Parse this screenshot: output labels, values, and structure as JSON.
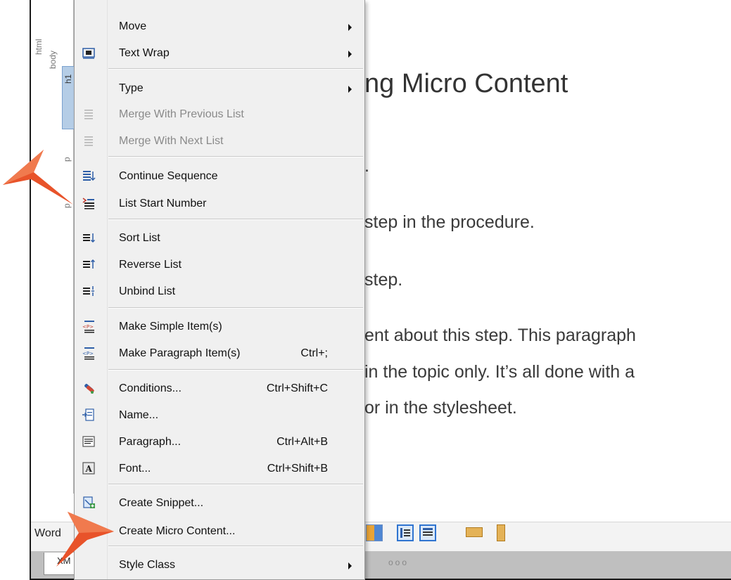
{
  "structure": {
    "html_label": "html",
    "body_label": "body",
    "h1_label": "h1",
    "p_label": "p"
  },
  "document": {
    "heading": "ng Micro Content",
    "fragment1": ".",
    "line_step1": "step in the procedure.",
    "line_step2": "step.",
    "line_p1": "ent about this step. This paragraph",
    "line_p2": "in the topic only. It’s all done with a",
    "line_p3": "or in the stylesheet."
  },
  "bottom": {
    "word_label": "Word",
    "xml_tab": "XM",
    "dots": "ooo"
  },
  "menu": {
    "items": [
      {
        "label": "Move",
        "shortcut": "",
        "submenu": true,
        "enabled": true,
        "icon": "none"
      },
      {
        "label": "Text Wrap",
        "shortcut": "",
        "submenu": true,
        "enabled": true,
        "icon": "text-wrap-icon"
      },
      {
        "label": "Type",
        "shortcut": "",
        "submenu": true,
        "enabled": true,
        "icon": "none"
      },
      {
        "label": "Merge With Previous List",
        "shortcut": "",
        "submenu": false,
        "enabled": false,
        "icon": "merge-previous-icon"
      },
      {
        "label": "Merge With Next List",
        "shortcut": "",
        "submenu": false,
        "enabled": false,
        "icon": "merge-next-icon"
      },
      {
        "label": "Continue Sequence",
        "shortcut": "",
        "submenu": false,
        "enabled": true,
        "icon": "continue-sequence-icon"
      },
      {
        "label": "List Start Number",
        "shortcut": "",
        "submenu": false,
        "enabled": true,
        "icon": "list-start-number-icon"
      },
      {
        "label": "Sort List",
        "shortcut": "",
        "submenu": false,
        "enabled": true,
        "icon": "sort-list-icon"
      },
      {
        "label": "Reverse List",
        "shortcut": "",
        "submenu": false,
        "enabled": true,
        "icon": "reverse-list-icon"
      },
      {
        "label": "Unbind List",
        "shortcut": "",
        "submenu": false,
        "enabled": true,
        "icon": "unbind-list-icon"
      },
      {
        "label": "Make Simple Item(s)",
        "shortcut": "",
        "submenu": false,
        "enabled": true,
        "icon": "simple-item-icon"
      },
      {
        "label": "Make Paragraph Item(s)",
        "shortcut": "Ctrl+;",
        "submenu": false,
        "enabled": true,
        "icon": "paragraph-item-icon"
      },
      {
        "label": "Conditions...",
        "shortcut": "Ctrl+Shift+C",
        "submenu": false,
        "enabled": true,
        "icon": "conditions-icon"
      },
      {
        "label": "Name...",
        "shortcut": "",
        "submenu": false,
        "enabled": true,
        "icon": "name-icon"
      },
      {
        "label": "Paragraph...",
        "shortcut": "Ctrl+Alt+B",
        "submenu": false,
        "enabled": true,
        "icon": "paragraph-icon"
      },
      {
        "label": "Font...",
        "shortcut": "Ctrl+Shift+B",
        "submenu": false,
        "enabled": true,
        "icon": "font-icon"
      },
      {
        "label": "Create Snippet...",
        "shortcut": "",
        "submenu": false,
        "enabled": true,
        "icon": "create-snippet-icon"
      },
      {
        "label": "Create Micro Content...",
        "shortcut": "",
        "submenu": false,
        "enabled": true,
        "icon": "none"
      },
      {
        "label": "Style Class",
        "shortcut": "",
        "submenu": true,
        "enabled": true,
        "icon": "none"
      }
    ]
  },
  "colors": {
    "callout_arrow": "#e8532a",
    "menu_bg": "#f0f0f0",
    "icon_blue": "#2f5fa8"
  }
}
